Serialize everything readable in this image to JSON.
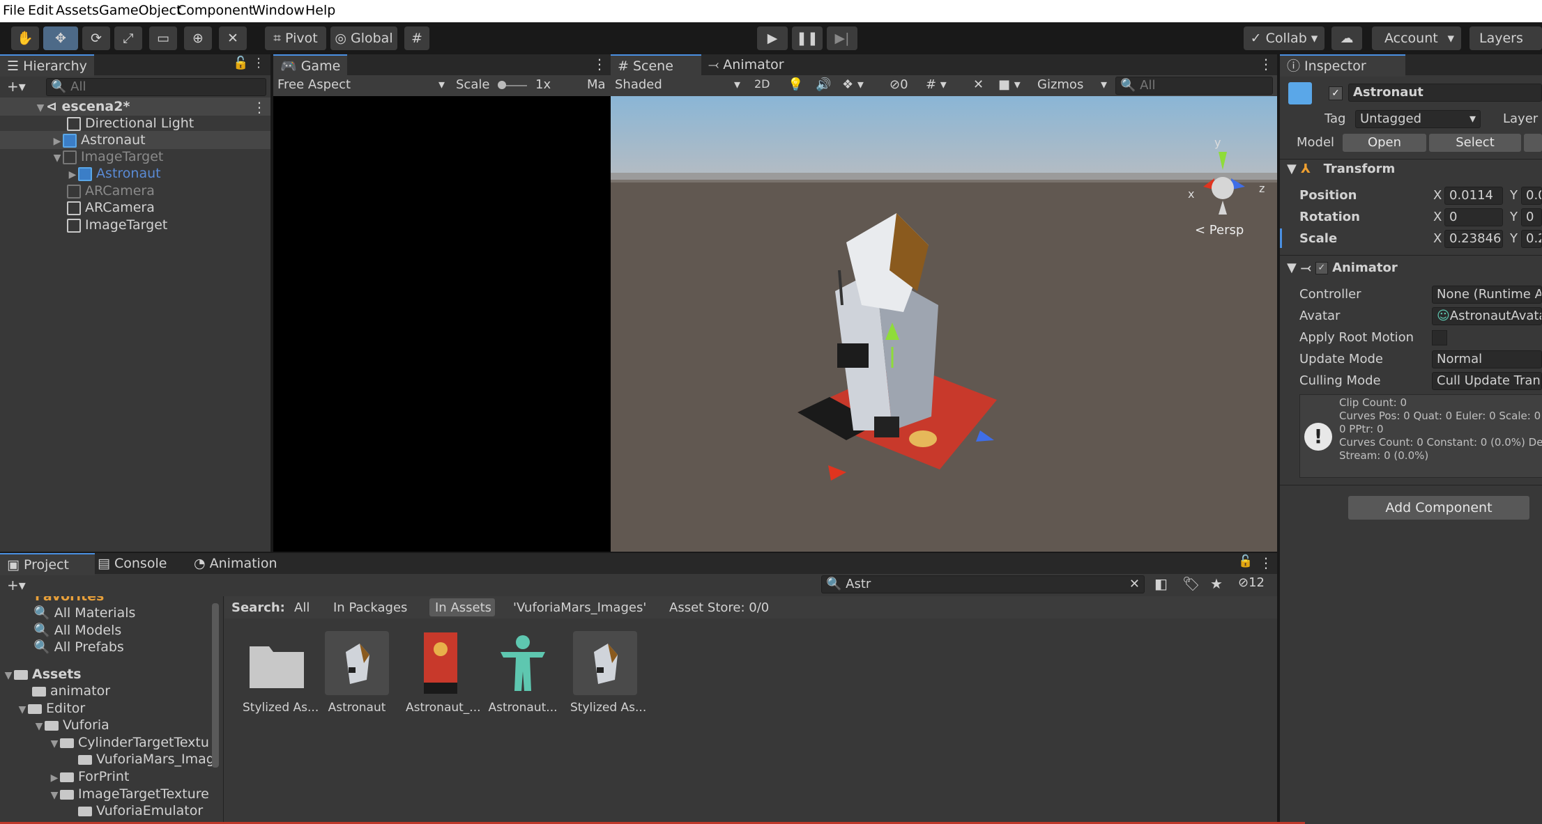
{
  "menu": [
    "File",
    "Edit",
    "Assets",
    "GameObject",
    "Component",
    "Window",
    "Help"
  ],
  "toolbar": {
    "pivot": "Pivot",
    "global": "Global",
    "collab": "Collab",
    "account": "Account",
    "layers": "Layers"
  },
  "hierarchy": {
    "tab": "Hierarchy",
    "search_placeholder": "All",
    "items": [
      {
        "label": "escena2*",
        "depth": 0,
        "style": "scene"
      },
      {
        "label": "Directional Light",
        "depth": 1,
        "style": "normal"
      },
      {
        "label": "Astronaut",
        "depth": 1,
        "style": "prefab"
      },
      {
        "label": "ImageTarget",
        "depth": 1,
        "style": "disabled"
      },
      {
        "label": "Astronaut",
        "depth": 2,
        "style": "prefab-dim"
      },
      {
        "label": "ARCamera",
        "depth": 1,
        "style": "disabled"
      },
      {
        "label": "ARCamera",
        "depth": 1,
        "style": "normal"
      },
      {
        "label": "ImageTarget",
        "depth": 1,
        "style": "normal"
      }
    ]
  },
  "game": {
    "tab": "Game",
    "aspect": "Free Aspect",
    "scale_label": "Scale",
    "scale_value": "1x",
    "max": "Ma"
  },
  "scene": {
    "tab_scene": "Scene",
    "tab_animator": "Animator",
    "shading": "Shaded",
    "mode2d": "2D",
    "hidden_count": "0",
    "gizmos": "Gizmos",
    "search_placeholder": "All",
    "persp": "< Persp",
    "axis_x": "x",
    "axis_y": "y",
    "axis_z": "z"
  },
  "inspector": {
    "tab": "Inspector",
    "name": "Astronaut",
    "tag_label": "Tag",
    "tag_value": "Untagged",
    "layer_label": "Layer",
    "model_label": "Model",
    "open": "Open",
    "select": "Select",
    "transform": {
      "title": "Transform",
      "position_label": "Position",
      "rotation_label": "Rotation",
      "scale_label": "Scale",
      "pos_x": "0.0114",
      "pos_y": "0.0",
      "rot_x": "0",
      "rot_y": "0",
      "scale_x": "0.23846",
      "scale_y": "0.2",
      "x": "X",
      "y": "Y"
    },
    "animator": {
      "title": "Animator",
      "controller_label": "Controller",
      "controller_value": "None (Runtime An",
      "avatar_label": "Avatar",
      "avatar_value": "AstronautAvata",
      "apply_root_motion": "Apply Root Motion",
      "update_mode_label": "Update Mode",
      "update_mode_value": "Normal",
      "culling_mode_label": "Culling Mode",
      "culling_mode_value": "Cull Update Tran"
    },
    "info": [
      "Clip Count: 0",
      "Curves Pos: 0 Quat: 0 Euler: 0 Scale: 0",
      "0 PPtr: 0",
      "Curves Count: 0 Constant: 0 (0.0%) De",
      "Stream: 0 (0.0%)"
    ],
    "add_component": "Add Component"
  },
  "project": {
    "tabs": [
      "Project",
      "Console",
      "Animation"
    ],
    "search_value": "Astr",
    "hidden_count": "12",
    "favorites_header": "Favorites",
    "favorites": [
      "All Materials",
      "All Models",
      "All Prefabs"
    ],
    "tree": [
      {
        "label": "Assets",
        "depth": 0,
        "bold": true
      },
      {
        "label": "animator",
        "depth": 1
      },
      {
        "label": "Editor",
        "depth": 1
      },
      {
        "label": "Vuforia",
        "depth": 2
      },
      {
        "label": "CylinderTargetTextu",
        "depth": 3
      },
      {
        "label": "VuforiaMars_Imag",
        "depth": 4
      },
      {
        "label": "ForPrint",
        "depth": 3
      },
      {
        "label": "ImageTargetTexture",
        "depth": 3
      },
      {
        "label": "VuforiaEmulator",
        "depth": 4
      }
    ],
    "search_label": "Search:",
    "filters": [
      "All",
      "In Packages",
      "In Assets",
      "'VuforiaMars_Images'",
      "Asset Store: 0/0"
    ],
    "assets": [
      "Stylized As...",
      "Astronaut",
      "Astronaut_...",
      "Astronaut...",
      "Stylized As..."
    ]
  },
  "colors": {
    "accent": "#4a90e2",
    "panel": "#383838",
    "dark": "#191919"
  }
}
